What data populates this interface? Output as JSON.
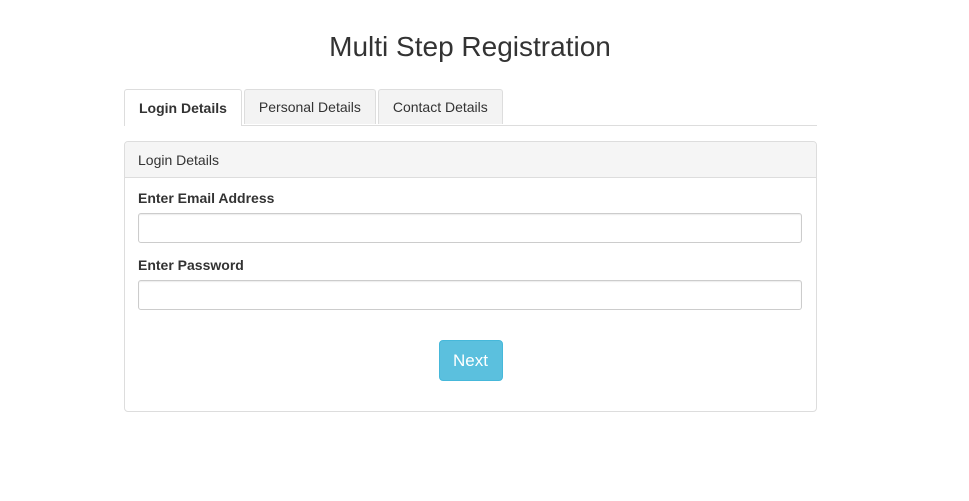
{
  "header": {
    "title": "Multi Step Registration"
  },
  "tabs": [
    {
      "label": "Login Details",
      "active": true
    },
    {
      "label": "Personal Details",
      "active": false
    },
    {
      "label": "Contact Details",
      "active": false
    }
  ],
  "panel": {
    "heading": "Login Details",
    "fields": {
      "email": {
        "label": "Enter Email Address",
        "value": "",
        "placeholder": ""
      },
      "password": {
        "label": "Enter Password",
        "value": "",
        "placeholder": ""
      }
    },
    "next_label": "Next"
  },
  "colors": {
    "accent_button": "#5bc0de",
    "panel_heading_bg": "#f5f5f5",
    "border": "#dddddd"
  }
}
